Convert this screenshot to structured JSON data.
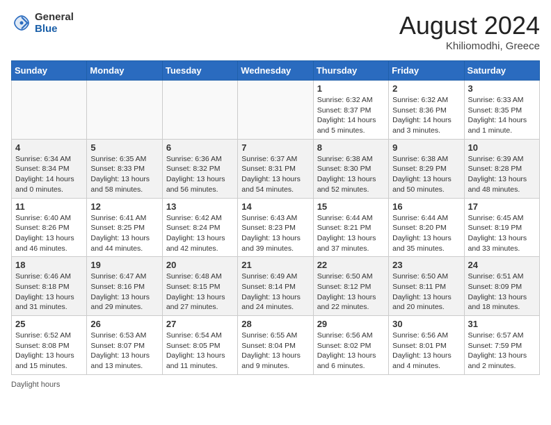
{
  "header": {
    "logo_general": "General",
    "logo_blue": "Blue",
    "title": "August 2024",
    "location": "Khiliomodhi, Greece"
  },
  "days_of_week": [
    "Sunday",
    "Monday",
    "Tuesday",
    "Wednesday",
    "Thursday",
    "Friday",
    "Saturday"
  ],
  "weeks": [
    {
      "days": [
        {
          "num": "",
          "info": ""
        },
        {
          "num": "",
          "info": ""
        },
        {
          "num": "",
          "info": ""
        },
        {
          "num": "",
          "info": ""
        },
        {
          "num": "1",
          "info": "Sunrise: 6:32 AM\nSunset: 8:37 PM\nDaylight: 14 hours and 5 minutes."
        },
        {
          "num": "2",
          "info": "Sunrise: 6:32 AM\nSunset: 8:36 PM\nDaylight: 14 hours and 3 minutes."
        },
        {
          "num": "3",
          "info": "Sunrise: 6:33 AM\nSunset: 8:35 PM\nDaylight: 14 hours and 1 minute."
        }
      ]
    },
    {
      "days": [
        {
          "num": "4",
          "info": "Sunrise: 6:34 AM\nSunset: 8:34 PM\nDaylight: 14 hours and 0 minutes."
        },
        {
          "num": "5",
          "info": "Sunrise: 6:35 AM\nSunset: 8:33 PM\nDaylight: 13 hours and 58 minutes."
        },
        {
          "num": "6",
          "info": "Sunrise: 6:36 AM\nSunset: 8:32 PM\nDaylight: 13 hours and 56 minutes."
        },
        {
          "num": "7",
          "info": "Sunrise: 6:37 AM\nSunset: 8:31 PM\nDaylight: 13 hours and 54 minutes."
        },
        {
          "num": "8",
          "info": "Sunrise: 6:38 AM\nSunset: 8:30 PM\nDaylight: 13 hours and 52 minutes."
        },
        {
          "num": "9",
          "info": "Sunrise: 6:38 AM\nSunset: 8:29 PM\nDaylight: 13 hours and 50 minutes."
        },
        {
          "num": "10",
          "info": "Sunrise: 6:39 AM\nSunset: 8:28 PM\nDaylight: 13 hours and 48 minutes."
        }
      ]
    },
    {
      "days": [
        {
          "num": "11",
          "info": "Sunrise: 6:40 AM\nSunset: 8:26 PM\nDaylight: 13 hours and 46 minutes."
        },
        {
          "num": "12",
          "info": "Sunrise: 6:41 AM\nSunset: 8:25 PM\nDaylight: 13 hours and 44 minutes."
        },
        {
          "num": "13",
          "info": "Sunrise: 6:42 AM\nSunset: 8:24 PM\nDaylight: 13 hours and 42 minutes."
        },
        {
          "num": "14",
          "info": "Sunrise: 6:43 AM\nSunset: 8:23 PM\nDaylight: 13 hours and 39 minutes."
        },
        {
          "num": "15",
          "info": "Sunrise: 6:44 AM\nSunset: 8:21 PM\nDaylight: 13 hours and 37 minutes."
        },
        {
          "num": "16",
          "info": "Sunrise: 6:44 AM\nSunset: 8:20 PM\nDaylight: 13 hours and 35 minutes."
        },
        {
          "num": "17",
          "info": "Sunrise: 6:45 AM\nSunset: 8:19 PM\nDaylight: 13 hours and 33 minutes."
        }
      ]
    },
    {
      "days": [
        {
          "num": "18",
          "info": "Sunrise: 6:46 AM\nSunset: 8:18 PM\nDaylight: 13 hours and 31 minutes."
        },
        {
          "num": "19",
          "info": "Sunrise: 6:47 AM\nSunset: 8:16 PM\nDaylight: 13 hours and 29 minutes."
        },
        {
          "num": "20",
          "info": "Sunrise: 6:48 AM\nSunset: 8:15 PM\nDaylight: 13 hours and 27 minutes."
        },
        {
          "num": "21",
          "info": "Sunrise: 6:49 AM\nSunset: 8:14 PM\nDaylight: 13 hours and 24 minutes."
        },
        {
          "num": "22",
          "info": "Sunrise: 6:50 AM\nSunset: 8:12 PM\nDaylight: 13 hours and 22 minutes."
        },
        {
          "num": "23",
          "info": "Sunrise: 6:50 AM\nSunset: 8:11 PM\nDaylight: 13 hours and 20 minutes."
        },
        {
          "num": "24",
          "info": "Sunrise: 6:51 AM\nSunset: 8:09 PM\nDaylight: 13 hours and 18 minutes."
        }
      ]
    },
    {
      "days": [
        {
          "num": "25",
          "info": "Sunrise: 6:52 AM\nSunset: 8:08 PM\nDaylight: 13 hours and 15 minutes."
        },
        {
          "num": "26",
          "info": "Sunrise: 6:53 AM\nSunset: 8:07 PM\nDaylight: 13 hours and 13 minutes."
        },
        {
          "num": "27",
          "info": "Sunrise: 6:54 AM\nSunset: 8:05 PM\nDaylight: 13 hours and 11 minutes."
        },
        {
          "num": "28",
          "info": "Sunrise: 6:55 AM\nSunset: 8:04 PM\nDaylight: 13 hours and 9 minutes."
        },
        {
          "num": "29",
          "info": "Sunrise: 6:56 AM\nSunset: 8:02 PM\nDaylight: 13 hours and 6 minutes."
        },
        {
          "num": "30",
          "info": "Sunrise: 6:56 AM\nSunset: 8:01 PM\nDaylight: 13 hours and 4 minutes."
        },
        {
          "num": "31",
          "info": "Sunrise: 6:57 AM\nSunset: 7:59 PM\nDaylight: 13 hours and 2 minutes."
        }
      ]
    }
  ],
  "footer": "Daylight hours"
}
